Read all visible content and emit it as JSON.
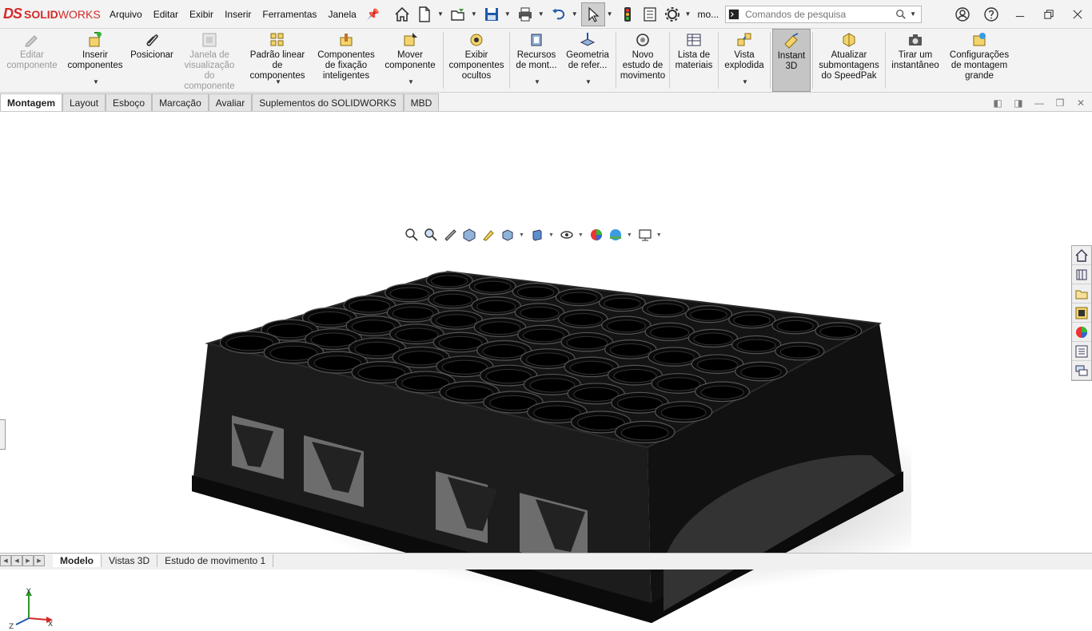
{
  "app": {
    "brand_ds": "DS",
    "brand_solid": "SOLID",
    "brand_works": "WORKS"
  },
  "menus": [
    "Arquivo",
    "Editar",
    "Exibir",
    "Inserir",
    "Ferramentas",
    "Janela"
  ],
  "quick": {
    "more_label": "mo..."
  },
  "search": {
    "placeholder": "Comandos de pesquisa"
  },
  "ribbon": [
    {
      "label": "Editar\ncomponente",
      "disabled": true
    },
    {
      "label": "Inserir\ncomponentes",
      "dropdown": true
    },
    {
      "label": "Posicionar"
    },
    {
      "label": "Janela de\nvisualização do\ncomponente",
      "disabled": true
    },
    {
      "label": "Padrão linear de\ncomponentes",
      "dropdown": true
    },
    {
      "label": "Componentes\nde fixação\ninteligentes"
    },
    {
      "label": "Mover\ncomponente",
      "dropdown": true
    },
    {
      "label": "Exibir\ncomponentes\nocultos"
    },
    {
      "label": "Recursos\nde mont...",
      "dropdown": true
    },
    {
      "label": "Geometria\nde refer...",
      "dropdown": true
    },
    {
      "label": "Novo\nestudo de\nmovimento"
    },
    {
      "label": "Lista de\nmateriais"
    },
    {
      "label": "Vista\nexplodida",
      "dropdown": true
    },
    {
      "label": "Instant\n3D",
      "active": true
    },
    {
      "label": "Atualizar\nsubmontagens\ndo SpeedPak"
    },
    {
      "label": "Tirar um\ninstantâneo"
    },
    {
      "label": "Configurações\nde montagem\ngrande"
    }
  ],
  "tabs": [
    "Montagem",
    "Layout",
    "Esboço",
    "Marcação",
    "Avaliar",
    "Suplementos do SOLIDWORKS",
    "MBD"
  ],
  "active_tab": "Montagem",
  "triad": {
    "x": "X",
    "y": "Y",
    "z": "Z"
  },
  "bottom_tabs": [
    "Modelo",
    "Vistas 3D",
    "Estudo de movimento 1"
  ],
  "active_bottom_tab": "Modelo",
  "colors": {
    "brand": "#d42a2a",
    "model": "#1a1a1a",
    "ui_bg": "#f3f3f3"
  }
}
